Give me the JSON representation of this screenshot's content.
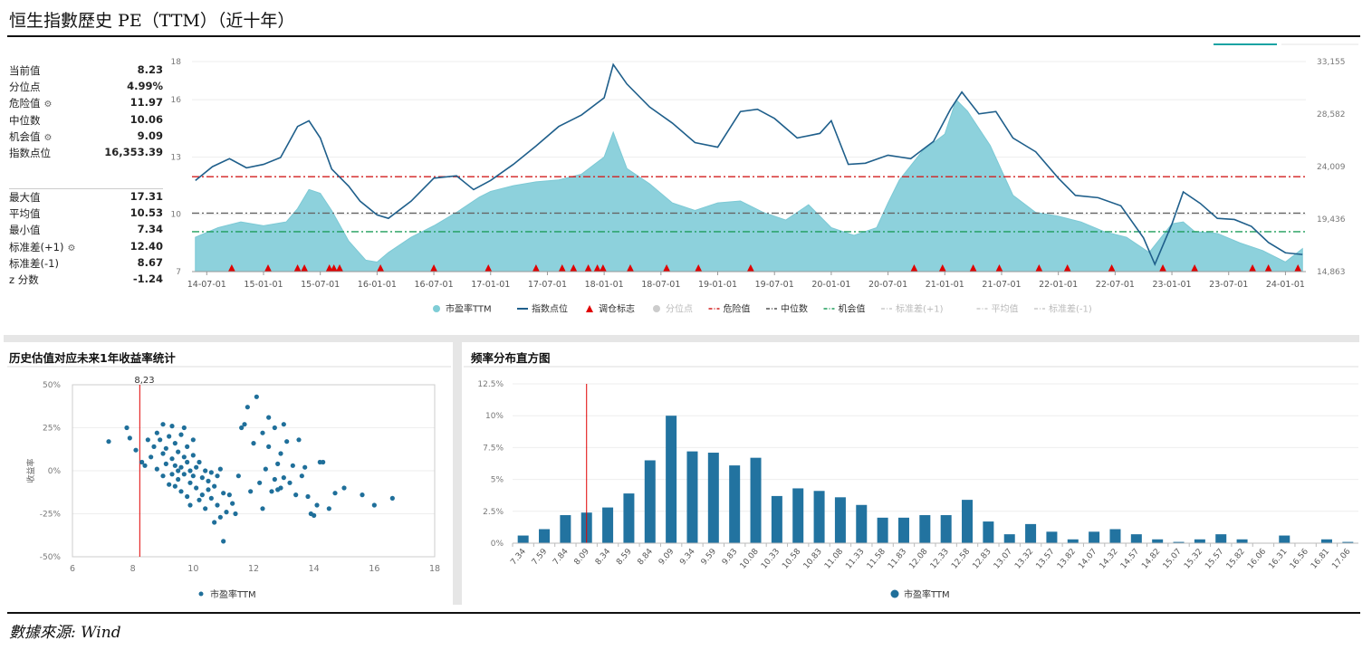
{
  "title": "恒生指數歷史 PE（TTM）（近十年）",
  "source": "數據來源: Wind",
  "stats": {
    "current": [
      {
        "label": "当前值",
        "value": "8.23",
        "gear": false
      },
      {
        "label": "分位点",
        "value": "4.99%",
        "gear": false
      },
      {
        "label": "危险值",
        "value": "11.97",
        "gear": true
      },
      {
        "label": "中位数",
        "value": "10.06",
        "gear": false
      },
      {
        "label": "机会值",
        "value": "9.09",
        "gear": true
      },
      {
        "label": "指数点位",
        "value": "16,353.39",
        "gear": false
      }
    ],
    "summary": [
      {
        "label": "最大值",
        "value": "17.31",
        "gear": false
      },
      {
        "label": "平均值",
        "value": "10.53",
        "gear": false
      },
      {
        "label": "最小值",
        "value": "7.34",
        "gear": false
      },
      {
        "label": "标准差(+1)",
        "value": "12.40",
        "gear": true
      },
      {
        "label": "标准差(-1)",
        "value": "8.67",
        "gear": false
      },
      {
        "label": "z 分数",
        "value": "-1.24",
        "gear": false
      }
    ]
  },
  "panels": {
    "scatter_title": "历史估值对应未来1年收益率统计",
    "hist_title": "频率分布直方图"
  },
  "legend_main": [
    {
      "label": "市盈率TTM",
      "type": "dot",
      "color": "#7fcdd6",
      "active": true
    },
    {
      "label": "指数点位",
      "type": "line",
      "color": "#1f5f8b",
      "active": true
    },
    {
      "label": "调仓标志",
      "type": "triangle",
      "color": "#e00000",
      "active": true
    },
    {
      "label": "分位点",
      "type": "dot",
      "color": "#cccccc",
      "active": false
    },
    {
      "label": "危险值",
      "type": "dashdot",
      "color": "#d21e1e",
      "active": true
    },
    {
      "label": "中位数",
      "type": "dashdot",
      "color": "#555555",
      "active": true
    },
    {
      "label": "机会值",
      "type": "dashdot",
      "color": "#1f9d5b",
      "active": true
    },
    {
      "label": "标准差(+1)",
      "type": "dashdot",
      "color": "#cccccc",
      "active": false
    },
    {
      "label": "平均值",
      "type": "dashdot",
      "color": "#cccccc",
      "active": false
    },
    {
      "label": "标准差(-1)",
      "type": "dashdot",
      "color": "#cccccc",
      "active": false
    }
  ],
  "chart_data": [
    {
      "type": "area",
      "x_ticks": [
        "14-07-01",
        "15-01-01",
        "15-07-01",
        "16-01-01",
        "16-07-01",
        "17-01-01",
        "17-07-01",
        "18-01-01",
        "18-07-01",
        "19-01-01",
        "19-07-01",
        "20-01-01",
        "20-07-01",
        "21-01-01",
        "21-07-01",
        "22-01-01",
        "22-07-01",
        "23-01-01",
        "23-07-01",
        "24-01-01"
      ],
      "x_range": [
        2014.37,
        2024.18
      ],
      "y_left": {
        "ticks": [
          "7",
          "10",
          "13",
          "16",
          "18"
        ],
        "range": [
          7,
          18
        ]
      },
      "y_right": {
        "ticks": [
          "14,863",
          "19,436",
          "24,009",
          "28,582",
          "33,155"
        ],
        "range": [
          14863,
          33155
        ]
      },
      "reference_lines": {
        "danger": 11.97,
        "median": 10.06,
        "opportunity": 9.09
      },
      "pe_series": {
        "name": "市盈率TTM",
        "x": [
          2014.4,
          2014.6,
          2014.8,
          2015.0,
          2015.2,
          2015.3,
          2015.4,
          2015.5,
          2015.6,
          2015.75,
          2015.9,
          2016.0,
          2016.1,
          2016.3,
          2016.5,
          2016.7,
          2016.9,
          2017.0,
          2017.2,
          2017.4,
          2017.6,
          2017.8,
          2018.0,
          2018.08,
          2018.2,
          2018.4,
          2018.6,
          2018.8,
          2019.0,
          2019.2,
          2019.4,
          2019.6,
          2019.8,
          2020.0,
          2020.2,
          2020.4,
          2020.5,
          2020.6,
          2020.8,
          2021.0,
          2021.1,
          2021.2,
          2021.4,
          2021.6,
          2021.8,
          2022.0,
          2022.2,
          2022.4,
          2022.6,
          2022.8,
          2023.0,
          2023.1,
          2023.2,
          2023.4,
          2023.6,
          2023.8,
          2024.0,
          2024.15
        ],
        "y": [
          8.8,
          9.3,
          9.6,
          9.4,
          9.6,
          10.3,
          11.3,
          11.1,
          10.2,
          8.6,
          7.6,
          7.5,
          8.0,
          8.8,
          9.4,
          10.1,
          10.9,
          11.2,
          11.5,
          11.7,
          11.8,
          12.1,
          13.0,
          14.3,
          12.4,
          11.6,
          10.6,
          10.2,
          10.6,
          10.7,
          10.1,
          9.7,
          10.5,
          9.3,
          8.9,
          9.3,
          10.6,
          11.8,
          13.3,
          14.2,
          16.0,
          15.4,
          13.6,
          11.0,
          10.1,
          9.9,
          9.6,
          9.1,
          8.8,
          8.0,
          9.5,
          9.6,
          9.1,
          9.0,
          8.5,
          8.1,
          7.5,
          8.2
        ]
      },
      "index_series": {
        "name": "指数点位",
        "x": [
          2014.4,
          2014.55,
          2014.7,
          2014.85,
          2015.0,
          2015.15,
          2015.3,
          2015.4,
          2015.5,
          2015.6,
          2015.75,
          2015.85,
          2016.0,
          2016.1,
          2016.3,
          2016.5,
          2016.7,
          2016.85,
          2017.0,
          2017.2,
          2017.4,
          2017.6,
          2017.8,
          2018.0,
          2018.08,
          2018.2,
          2018.4,
          2018.6,
          2018.8,
          2019.0,
          2019.2,
          2019.35,
          2019.5,
          2019.7,
          2019.9,
          2020.0,
          2020.15,
          2020.3,
          2020.5,
          2020.7,
          2020.9,
          2021.05,
          2021.15,
          2021.3,
          2021.45,
          2021.6,
          2021.8,
          2022.0,
          2022.15,
          2022.35,
          2022.55,
          2022.75,
          2022.85,
          2023.0,
          2023.1,
          2023.25,
          2023.4,
          2023.55,
          2023.7,
          2023.85,
          2024.0,
          2024.15
        ],
        "y": [
          22800,
          24000,
          24700,
          23900,
          24200,
          24800,
          27500,
          28000,
          26500,
          23800,
          22300,
          21000,
          19800,
          19500,
          21000,
          23000,
          23200,
          22000,
          22800,
          24200,
          25800,
          27500,
          28500,
          30000,
          32900,
          31200,
          29200,
          27800,
          26100,
          25700,
          28800,
          29000,
          28200,
          26500,
          26900,
          28000,
          24200,
          24300,
          25000,
          24700,
          26200,
          29000,
          30500,
          28600,
          28800,
          26500,
          25300,
          23000,
          21500,
          21300,
          20600,
          17800,
          15500,
          19000,
          21800,
          20800,
          19500,
          19400,
          18800,
          17400,
          16500,
          16350
        ]
      },
      "rebalance_marks_x": [
        2014.72,
        2015.04,
        2015.3,
        2015.36,
        2015.58,
        2015.62,
        2015.67,
        2016.03,
        2016.5,
        2016.98,
        2017.4,
        2017.63,
        2017.73,
        2017.86,
        2017.94,
        2017.99,
        2018.23,
        2018.55,
        2018.83,
        2019.29,
        2020.73,
        2020.98,
        2021.25,
        2021.48,
        2021.83,
        2022.08,
        2022.47,
        2022.92,
        2023.2,
        2023.71,
        2023.85,
        2024.11
      ]
    },
    {
      "type": "scatter",
      "title": "历史估值对应未来1年收益率统计",
      "xlabel": "",
      "ylabel": "收益率",
      "x_ticks": [
        "6",
        "8",
        "10",
        "12",
        "14",
        "16",
        "18"
      ],
      "y_ticks": [
        "50%",
        "25%",
        "0%",
        "-25%",
        "-50%"
      ],
      "xlim": [
        6,
        18
      ],
      "ylim": [
        -50,
        50
      ],
      "current_marker": {
        "x": 8.23,
        "label": "8,23"
      },
      "series_name": "市盈率TTM",
      "points": [
        [
          7.2,
          17
        ],
        [
          7.8,
          25
        ],
        [
          7.9,
          19
        ],
        [
          8.1,
          12
        ],
        [
          8.3,
          5
        ],
        [
          8.4,
          3
        ],
        [
          8.5,
          18
        ],
        [
          8.6,
          8
        ],
        [
          8.7,
          14
        ],
        [
          8.8,
          22
        ],
        [
          8.8,
          1
        ],
        [
          8.9,
          18
        ],
        [
          9.0,
          27
        ],
        [
          9.0,
          10
        ],
        [
          9.0,
          -3
        ],
        [
          9.1,
          13
        ],
        [
          9.1,
          4
        ],
        [
          9.2,
          -8
        ],
        [
          9.2,
          20
        ],
        [
          9.3,
          -2
        ],
        [
          9.3,
          26
        ],
        [
          9.3,
          7
        ],
        [
          9.4,
          -9
        ],
        [
          9.4,
          3
        ],
        [
          9.4,
          16
        ],
        [
          9.5,
          0
        ],
        [
          9.5,
          -5
        ],
        [
          9.5,
          11
        ],
        [
          9.6,
          21
        ],
        [
          9.6,
          2
        ],
        [
          9.6,
          -12
        ],
        [
          9.7,
          -2
        ],
        [
          9.7,
          8
        ],
        [
          9.7,
          25
        ],
        [
          9.8,
          -15
        ],
        [
          9.8,
          5
        ],
        [
          9.8,
          14
        ],
        [
          9.9,
          -20
        ],
        [
          9.9,
          0
        ],
        [
          9.9,
          -7
        ],
        [
          10.0,
          18
        ],
        [
          10.0,
          -3
        ],
        [
          10.0,
          9
        ],
        [
          10.1,
          -10
        ],
        [
          10.1,
          2
        ],
        [
          10.2,
          -17
        ],
        [
          10.2,
          5
        ],
        [
          10.3,
          -4
        ],
        [
          10.3,
          -14
        ],
        [
          10.4,
          -22
        ],
        [
          10.4,
          0
        ],
        [
          10.5,
          -6
        ],
        [
          10.5,
          -11
        ],
        [
          10.6,
          -1
        ],
        [
          10.6,
          -16
        ],
        [
          10.7,
          -30
        ],
        [
          10.7,
          -9
        ],
        [
          10.8,
          -3
        ],
        [
          10.8,
          -20
        ],
        [
          10.9,
          -27
        ],
        [
          10.9,
          1
        ],
        [
          11.0,
          -13
        ],
        [
          11.0,
          -41
        ],
        [
          11.1,
          -24
        ],
        [
          11.2,
          -14
        ],
        [
          11.3,
          -19
        ],
        [
          11.4,
          -25
        ],
        [
          11.5,
          -3
        ],
        [
          11.6,
          25
        ],
        [
          11.7,
          27
        ],
        [
          11.8,
          37
        ],
        [
          11.9,
          -12
        ],
        [
          12.0,
          16
        ],
        [
          12.1,
          43
        ],
        [
          12.2,
          -7
        ],
        [
          12.3,
          -22
        ],
        [
          12.3,
          22
        ],
        [
          12.4,
          1
        ],
        [
          12.5,
          14
        ],
        [
          12.5,
          31
        ],
        [
          12.6,
          -12
        ],
        [
          12.7,
          25
        ],
        [
          12.7,
          -5
        ],
        [
          12.8,
          4
        ],
        [
          12.8,
          -11
        ],
        [
          12.9,
          -10
        ],
        [
          12.9,
          10
        ],
        [
          13.0,
          27
        ],
        [
          13.0,
          -4
        ],
        [
          13.1,
          17
        ],
        [
          13.2,
          -7
        ],
        [
          13.3,
          3
        ],
        [
          13.4,
          -14
        ],
        [
          13.5,
          18
        ],
        [
          13.6,
          -3
        ],
        [
          13.7,
          2
        ],
        [
          13.8,
          -15
        ],
        [
          13.9,
          -25
        ],
        [
          14.0,
          -26
        ],
        [
          14.1,
          -20
        ],
        [
          14.2,
          5
        ],
        [
          14.3,
          5
        ],
        [
          14.5,
          -22
        ],
        [
          14.7,
          -13
        ],
        [
          15.0,
          -10
        ],
        [
          15.6,
          -14
        ],
        [
          16.0,
          -20
        ],
        [
          16.6,
          -16
        ]
      ]
    },
    {
      "type": "bar",
      "title": "频率分布直方图",
      "series_name": "市盈率TTM",
      "y_ticks": [
        "12.5%",
        "10%",
        "7.5%",
        "5%",
        "2.5%",
        "0%"
      ],
      "ylim": [
        0,
        12.5
      ],
      "current_marker_category": "8.09",
      "categories": [
        "7.34",
        "7.59",
        "7.84",
        "8.09",
        "8.34",
        "8.59",
        "8.84",
        "9.09",
        "9.34",
        "9.59",
        "9.83",
        "10.08",
        "10.33",
        "10.58",
        "10.83",
        "11.08",
        "11.33",
        "11.58",
        "11.83",
        "12.08",
        "12.33",
        "12.58",
        "12.83",
        "13.07",
        "13.32",
        "13.57",
        "13.82",
        "14.07",
        "14.32",
        "14.57",
        "14.82",
        "15.07",
        "15.32",
        "15.57",
        "15.82",
        "16.06",
        "16.31",
        "16.56",
        "16.81",
        "17.06"
      ],
      "values": [
        0.6,
        1.1,
        2.2,
        2.4,
        2.8,
        3.9,
        6.5,
        10.0,
        7.2,
        7.1,
        6.1,
        6.7,
        3.7,
        4.3,
        4.1,
        3.6,
        3.0,
        2.0,
        2.0,
        2.2,
        2.2,
        3.4,
        1.7,
        0.7,
        1.5,
        0.9,
        0.3,
        0.9,
        1.1,
        0.7,
        0.3,
        0.1,
        0.3,
        0.7,
        0.3,
        0.0,
        0.6,
        0.0,
        0.3,
        0.1
      ]
    }
  ]
}
